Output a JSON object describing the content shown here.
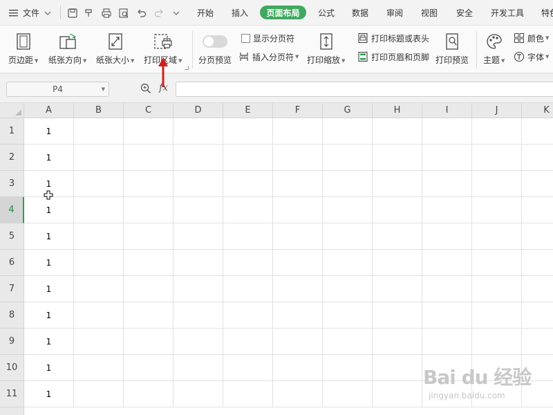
{
  "menu": {
    "file_label": "文件",
    "tabs": [
      {
        "label": "开始"
      },
      {
        "label": "插入"
      },
      {
        "label": "页面布局",
        "active": true
      },
      {
        "label": "公式"
      },
      {
        "label": "数据"
      },
      {
        "label": "审阅"
      },
      {
        "label": "视图"
      },
      {
        "label": "安全"
      },
      {
        "label": "开发工具"
      },
      {
        "label": "特色"
      }
    ],
    "accent_color": "#3fa95f"
  },
  "ribbon": {
    "margins": "页边距",
    "orientation": "纸张方向",
    "size": "纸张大小",
    "print_area": "打印区域",
    "page_break_preview": "分页预览",
    "show_page_breaks": "显示分页符",
    "insert_page_break": "插入分页符",
    "print_scaling": "打印缩放",
    "print_titles": "打印标题或表头",
    "print_header_footer": "打印页眉和页脚",
    "print_preview": "打印预览",
    "theme": "主题",
    "colors": "颜色",
    "fonts": "字体"
  },
  "formula_bar": {
    "name_box": "P4",
    "fx_label": "fx",
    "formula": ""
  },
  "grid": {
    "columns": [
      "A",
      "B",
      "C",
      "D",
      "E",
      "F",
      "G",
      "H",
      "I",
      "J",
      "K"
    ],
    "rows": [
      {
        "num": "1",
        "a": "1"
      },
      {
        "num": "2",
        "a": "1"
      },
      {
        "num": "3",
        "a": "1"
      },
      {
        "num": "4",
        "a": "1",
        "selected": true
      },
      {
        "num": "5",
        "a": "1"
      },
      {
        "num": "6",
        "a": "1"
      },
      {
        "num": "7",
        "a": "1"
      },
      {
        "num": "8",
        "a": "1"
      },
      {
        "num": "9",
        "a": "1"
      },
      {
        "num": "10",
        "a": "1"
      },
      {
        "num": "11",
        "a": "1"
      }
    ]
  },
  "watermark": {
    "logo": "Bai du 经验",
    "url": "jingyan.baidu.com"
  }
}
